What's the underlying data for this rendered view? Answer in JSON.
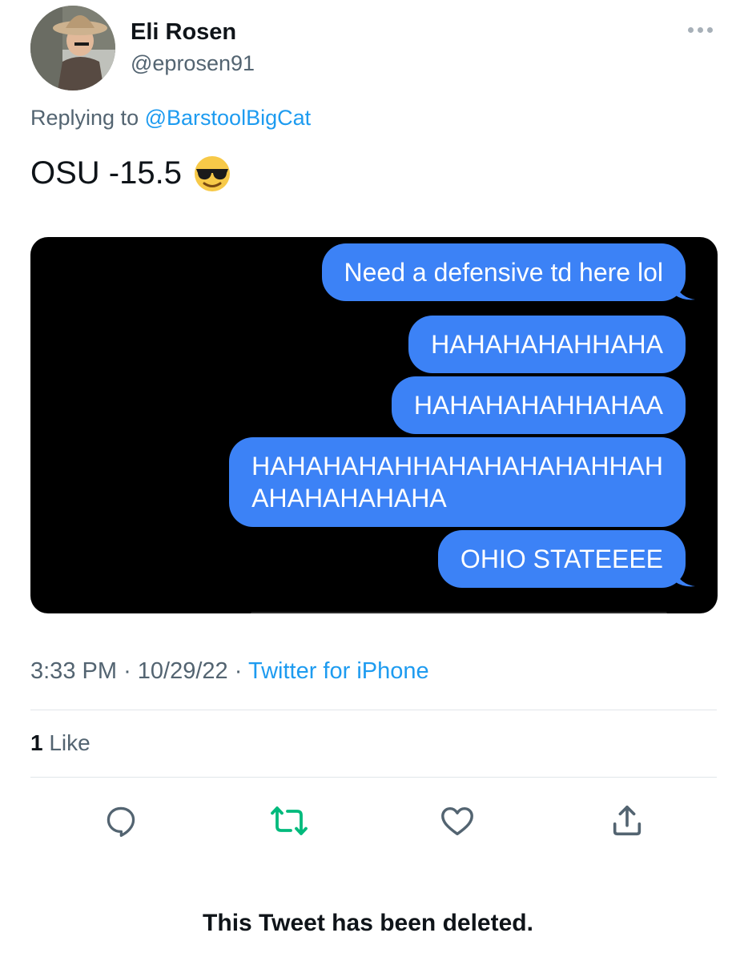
{
  "author": {
    "name": "Eli Rosen",
    "handle": "@eprosen91",
    "avatar": "avatar-cowboy-hat"
  },
  "reply": {
    "prefix": "Replying to",
    "mention": "@BarstoolBigCat"
  },
  "tweet": {
    "text": "OSU -15.5",
    "emoji": "smiling-face-with-sunglasses-emoji"
  },
  "media": {
    "messages": [
      "Need a defensive td here lol",
      "HAHAHAHAHHAHA",
      "HAHAHAHAHHAHAA",
      "HAHAHAHAHHAHAHAHAHAHHAH",
      "AHAHAHAHAHA",
      "OHIO STATEEEE"
    ],
    "bubble_color": "#3c82f6"
  },
  "meta": {
    "time": "3:33 PM",
    "sep1": "·",
    "date": "10/29/22",
    "sep2": "·",
    "source": "Twitter for iPhone"
  },
  "stats": {
    "like_count": "1",
    "like_label": "Like"
  },
  "actions": {
    "reply_icon": "reply-icon",
    "retweet_icon": "retweet-icon",
    "retweet_color": "#00ba7c",
    "like_icon": "heart-icon",
    "share_icon": "share-icon"
  },
  "footer": {
    "deleted_notice": "This Tweet has been deleted."
  }
}
